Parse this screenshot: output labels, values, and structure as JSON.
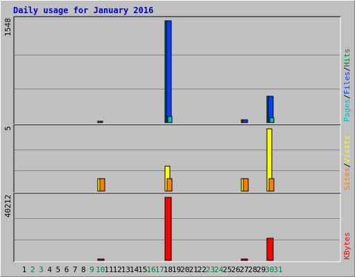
{
  "chart_data": {
    "type": "bar",
    "title": "Daily usage for January 2016",
    "title_color": "#0000cc",
    "categories": [
      "1",
      "2",
      "3",
      "4",
      "5",
      "6",
      "7",
      "8",
      "9",
      "10",
      "11",
      "12",
      "13",
      "14",
      "15",
      "16",
      "17",
      "18",
      "19",
      "20",
      "21",
      "22",
      "23",
      "24",
      "25",
      "26",
      "27",
      "28",
      "29",
      "30",
      "31"
    ],
    "weekend_days": [
      "2",
      "3",
      "9",
      "10",
      "16",
      "17",
      "23",
      "24",
      "30",
      "31"
    ],
    "weekday_color": "#000000",
    "weekend_color": "#008040",
    "grid": true,
    "panels": [
      {
        "name": "hits-files-pages",
        "ymax": 1548,
        "ymax_label": "1548",
        "legend": [
          {
            "label": "Pages",
            "color": "#00c0c0"
          },
          {
            "label": "Files",
            "color": "#0040ff"
          },
          {
            "label": "Hits",
            "color": "#008040"
          }
        ],
        "series": [
          {
            "name": "Hits",
            "color": "#008040",
            "values": [
              0,
              0,
              0,
              0,
              0,
              0,
              0,
              0,
              0,
              10,
              0,
              0,
              0,
              0,
              0,
              0,
              0,
              1548,
              0,
              0,
              0,
              0,
              0,
              0,
              0,
              0,
              40,
              0,
              0,
              400,
              0
            ]
          },
          {
            "name": "Files",
            "color": "#0040ff",
            "values": [
              0,
              0,
              0,
              0,
              0,
              0,
              0,
              0,
              0,
              0,
              0,
              0,
              0,
              0,
              0,
              0,
              0,
              1548,
              0,
              0,
              0,
              0,
              0,
              0,
              0,
              0,
              40,
              0,
              0,
              400,
              0
            ]
          },
          {
            "name": "Pages",
            "color": "#00c0c0",
            "values": [
              0,
              0,
              0,
              0,
              0,
              0,
              0,
              0,
              0,
              0,
              0,
              0,
              0,
              0,
              0,
              0,
              0,
              100,
              0,
              0,
              0,
              0,
              0,
              0,
              0,
              0,
              0,
              0,
              0,
              70,
              0
            ]
          }
        ]
      },
      {
        "name": "visits-sites",
        "ymax": 5,
        "ymax_label": "5",
        "legend": [
          {
            "label": "Sites",
            "color": "#ff8000"
          },
          {
            "label": "Visits",
            "color": "#ffff00"
          }
        ],
        "series": [
          {
            "name": "Visits",
            "color": "#ffff00",
            "values": [
              0,
              0,
              0,
              0,
              0,
              0,
              0,
              0,
              0,
              1,
              0,
              0,
              0,
              0,
              0,
              0,
              0,
              2,
              0,
              0,
              0,
              0,
              0,
              0,
              0,
              0,
              1,
              0,
              0,
              5,
              0
            ]
          },
          {
            "name": "Sites",
            "color": "#ff8000",
            "values": [
              0,
              0,
              0,
              0,
              0,
              0,
              0,
              0,
              0,
              1,
              0,
              0,
              0,
              0,
              0,
              0,
              0,
              1,
              0,
              0,
              0,
              0,
              0,
              0,
              0,
              0,
              1,
              0,
              0,
              1,
              0
            ]
          }
        ]
      },
      {
        "name": "kbytes",
        "ymax": 40212,
        "ymax_label": "40212",
        "legend": [
          {
            "label": "KBytes",
            "color": "#ff0000"
          }
        ],
        "series": [
          {
            "name": "KBytes",
            "color": "#ff0000",
            "values": [
              0,
              0,
              0,
              0,
              0,
              0,
              0,
              0,
              0,
              100,
              0,
              0,
              0,
              0,
              0,
              0,
              0,
              40212,
              0,
              0,
              0,
              0,
              0,
              0,
              0,
              0,
              100,
              0,
              0,
              14000,
              0
            ]
          }
        ]
      }
    ]
  }
}
